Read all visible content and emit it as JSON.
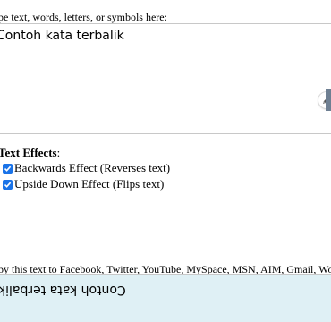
{
  "input": {
    "label": "pe text, words, letters, or symbols here:",
    "value": "Contoh kata terbalik",
    "pen_icon": "pen-icon"
  },
  "effects": {
    "heading": "Text Effects",
    "heading_suffix": ":",
    "options": [
      {
        "label": "Backwards Effect (Reverses text)",
        "checked": true
      },
      {
        "label": "Upside Down Effect (Flips text)",
        "checked": true
      }
    ]
  },
  "output": {
    "label": "py this text to Facebook, Twitter, YouTube, MySpace, MSN, AIM, Gmail, Word, e",
    "value": "Contoh kata terbalik"
  },
  "colors": {
    "checkbox": "#1a73e8",
    "output_bg": "#dff0f5"
  }
}
